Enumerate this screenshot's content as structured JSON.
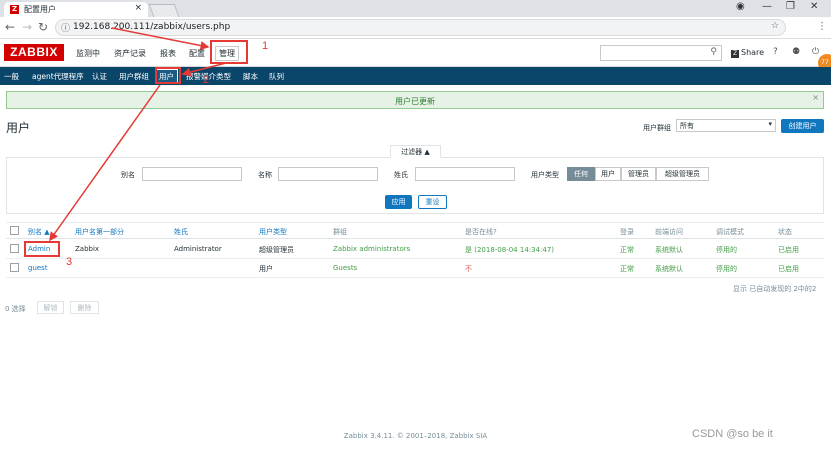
{
  "browser": {
    "tab_title": "配置用户",
    "url": "192.168.200.111/zabbix/users.php"
  },
  "header": {
    "logo": "ZABBIX",
    "menu": [
      "监测中",
      "资产记录",
      "报表",
      "配置",
      "管理"
    ],
    "share": "Share",
    "help": "?"
  },
  "submenu": [
    "一般",
    "agent代理程序",
    "认证",
    "用户群组",
    "用户",
    "报警媒介类型",
    "脚本",
    "队列"
  ],
  "message": "用户已更新",
  "page_title": "用户",
  "user_group_filter": {
    "label": "用户群组",
    "value": "所有"
  },
  "create_button": "创建用户",
  "filter": {
    "tab": "过滤器 ▲",
    "alias_label": "别名",
    "name_label": "名称",
    "surname_label": "姓氏",
    "type_label": "用户类型",
    "types": [
      "任何",
      "用户",
      "管理员",
      "超级管理员"
    ],
    "apply": "应用",
    "reset": "重设"
  },
  "table": {
    "headers": [
      "别名 ▲",
      "用户名第一部分",
      "姓氏",
      "用户类型",
      "群组",
      "是否在线?",
      "登录",
      "前端访问",
      "调试模式",
      "状态"
    ],
    "rows": [
      [
        "Admin",
        "Zabbix",
        "Administrator",
        "超级管理员",
        "Zabbix administrators",
        "是 (2018-08-04 14:34:47)",
        "正常",
        "系统默认",
        "停用的",
        "已启用"
      ],
      [
        "guest",
        "",
        "",
        "用户",
        "Guests",
        "不",
        "正常",
        "系统默认",
        "停用的",
        "已启用"
      ]
    ],
    "footer": "显示 已自动发现的 2中的2"
  },
  "bottom": {
    "selected": "0 选择",
    "unblock": "解锁",
    "delete": "删除"
  },
  "copyright": "Zabbix 3.4.11. © 2001–2018, Zabbix SIA",
  "watermark": "CSDN @so be it",
  "annotations": [
    "1",
    "2",
    "3"
  ],
  "colors": {
    "brand_red": "#d40000",
    "nav_blue": "#0a466a",
    "link_blue": "#1077bf",
    "ok_green": "#429e47",
    "annotation_red": "#e53935"
  }
}
